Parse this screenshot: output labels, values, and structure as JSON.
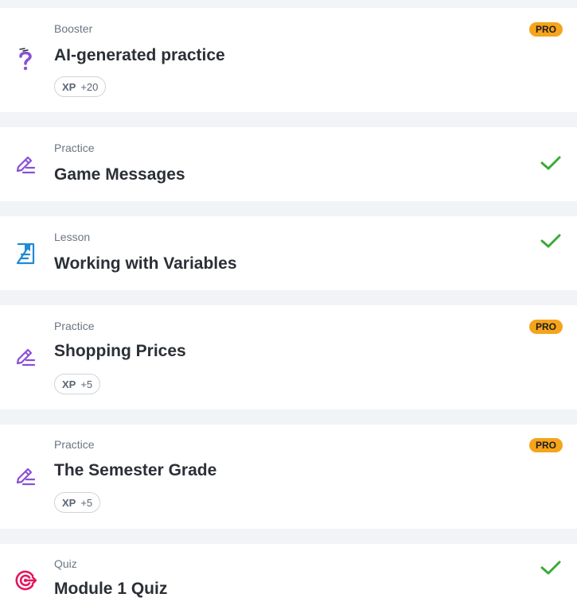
{
  "colors": {
    "page_bg": "#f1f3f6",
    "card_bg": "#ffffff",
    "practice_icon": "#8a4fd6",
    "lesson_icon": "#1f8ad6",
    "quiz_icon": "#e5145f",
    "pro_badge": "#f5a41b",
    "check": "#3aaa35"
  },
  "items": [
    {
      "type": "Booster",
      "title": "AI-generated practice",
      "icon": "question-icon",
      "pro": "PRO",
      "xp_label": "XP",
      "xp_value": "+20"
    },
    {
      "type": "Practice",
      "title": "Game Messages",
      "icon": "pencil-lines-icon",
      "completed": true
    },
    {
      "type": "Lesson",
      "title": "Working with Variables",
      "icon": "lesson-doc-icon",
      "completed": true
    },
    {
      "type": "Practice",
      "title": "Shopping Prices",
      "icon": "pencil-lines-icon",
      "pro": "PRO",
      "xp_label": "XP",
      "xp_value": "+5"
    },
    {
      "type": "Practice",
      "title": "The Semester Grade",
      "icon": "pencil-lines-icon",
      "pro": "PRO",
      "xp_label": "XP",
      "xp_value": "+5"
    },
    {
      "type": "Quiz",
      "title": "Module 1 Quiz",
      "icon": "target-icon",
      "completed": true
    }
  ]
}
